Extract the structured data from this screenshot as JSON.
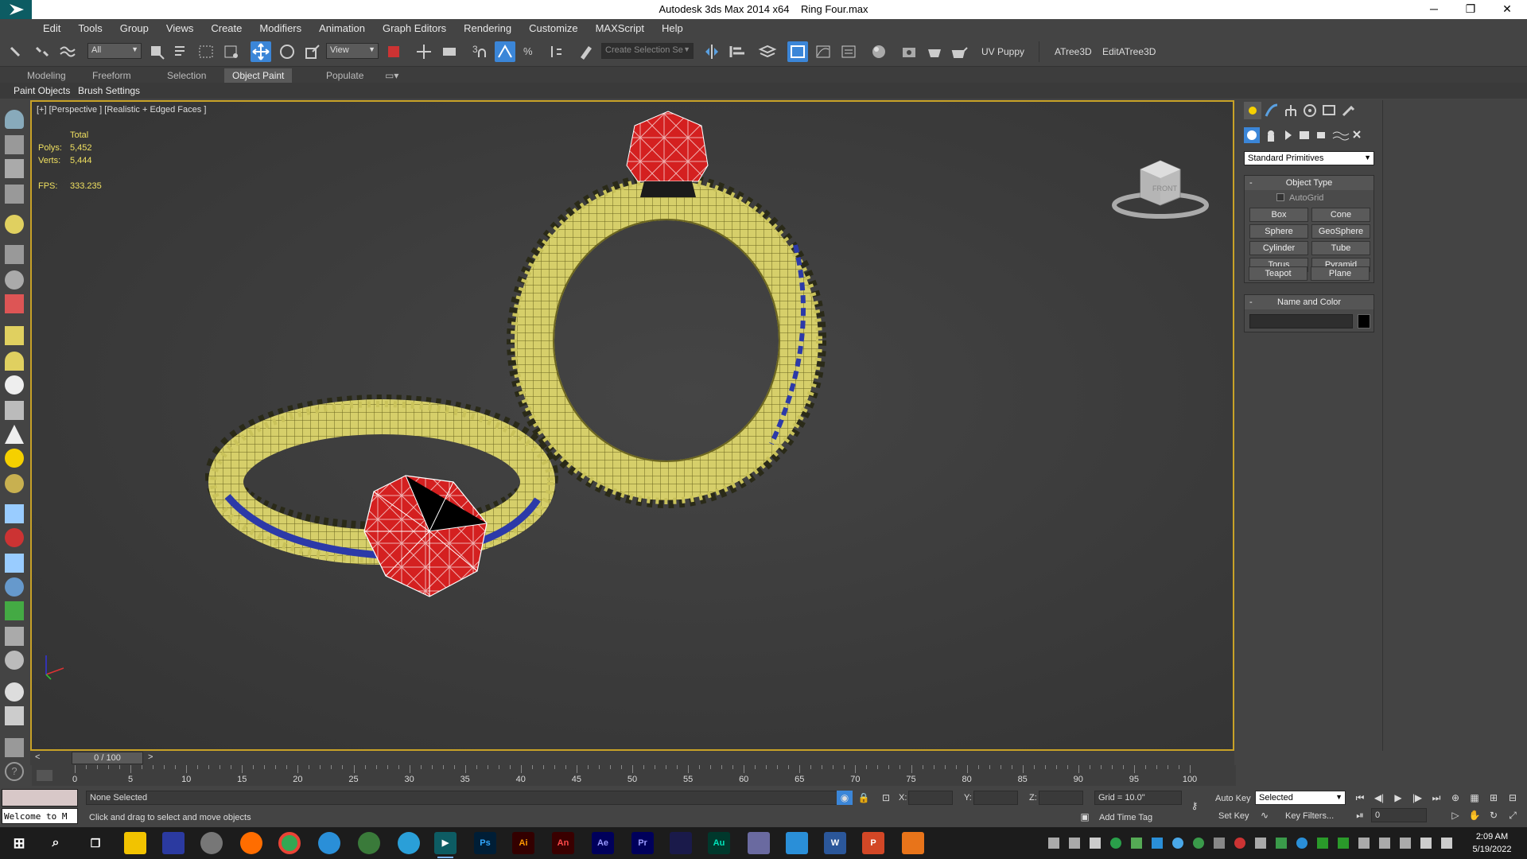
{
  "window": {
    "app_name": "Autodesk 3ds Max  2014 x64",
    "file_name": "Ring Four.max",
    "buttons": {
      "minimize": "─",
      "restore": "❐",
      "close": "✕"
    }
  },
  "menu": [
    "Edit",
    "Tools",
    "Group",
    "Views",
    "Create",
    "Modifiers",
    "Animation",
    "Graph Editors",
    "Rendering",
    "Customize",
    "MAXScript",
    "Help"
  ],
  "toolbar": {
    "selection_filter": "All",
    "ref_coord_system": "View",
    "snap_label": "3",
    "named_selection_placeholder": "Create Selection Se",
    "plugins": [
      "UV Puppy",
      "ATree3D",
      "EditATree3D"
    ]
  },
  "ribbon": {
    "tabs": [
      "Modeling",
      "Freeform",
      "Selection",
      "Object Paint",
      "Populate"
    ],
    "active_tab": "Object Paint",
    "sub_tabs": [
      "Paint Objects",
      "Brush Settings"
    ]
  },
  "viewport": {
    "label": "[+] [Perspective ] [Realistic + Edged Faces ]",
    "stats": {
      "header": "Total",
      "polys_label": "Polys:",
      "polys": "5,452",
      "verts_label": "Verts:",
      "verts": "5,444",
      "fps_label": "FPS:",
      "fps": "333.235"
    },
    "viewcube_face": "FRONT",
    "colors": {
      "gem": "#d42020",
      "band": "#d6cf6a",
      "stripe": "#2c3aa8",
      "frame": "#c8a227"
    }
  },
  "command_panel": {
    "category": "Standard Primitives",
    "object_type": {
      "title": "Object Type",
      "autogrid": "AutoGrid",
      "buttons": [
        "Box",
        "Cone",
        "Sphere",
        "GeoSphere",
        "Cylinder",
        "Tube",
        "Torus",
        "Pyramid",
        "Teapot",
        "Plane"
      ]
    },
    "name_and_color": {
      "title": "Name and Color",
      "name_value": ""
    }
  },
  "timeline": {
    "slider": "0 / 100",
    "ticks": [
      "0",
      "5",
      "10",
      "15",
      "20",
      "25",
      "30",
      "35",
      "40",
      "45",
      "50",
      "55",
      "60",
      "65",
      "70",
      "75",
      "80",
      "85",
      "90",
      "95",
      "100"
    ]
  },
  "status": {
    "welcome": "Welcome to M",
    "selection": "None Selected",
    "prompt": "Click and drag to select and move objects",
    "x_label": "X:",
    "y_label": "Y:",
    "z_label": "Z:",
    "grid": "Grid = 10.0\"",
    "add_time_tag": "Add Time Tag",
    "auto_key": "Auto Key",
    "set_key": "Set Key",
    "key_mode": "Selected",
    "key_filters": "Key Filters...",
    "frame": "0"
  },
  "taskbar": {
    "apps": [
      "Ps",
      "Ai",
      "An",
      "Ae",
      "Pr",
      "Au",
      "W",
      "P"
    ],
    "time": "2:09 AM",
    "date": "5/19/2022"
  }
}
